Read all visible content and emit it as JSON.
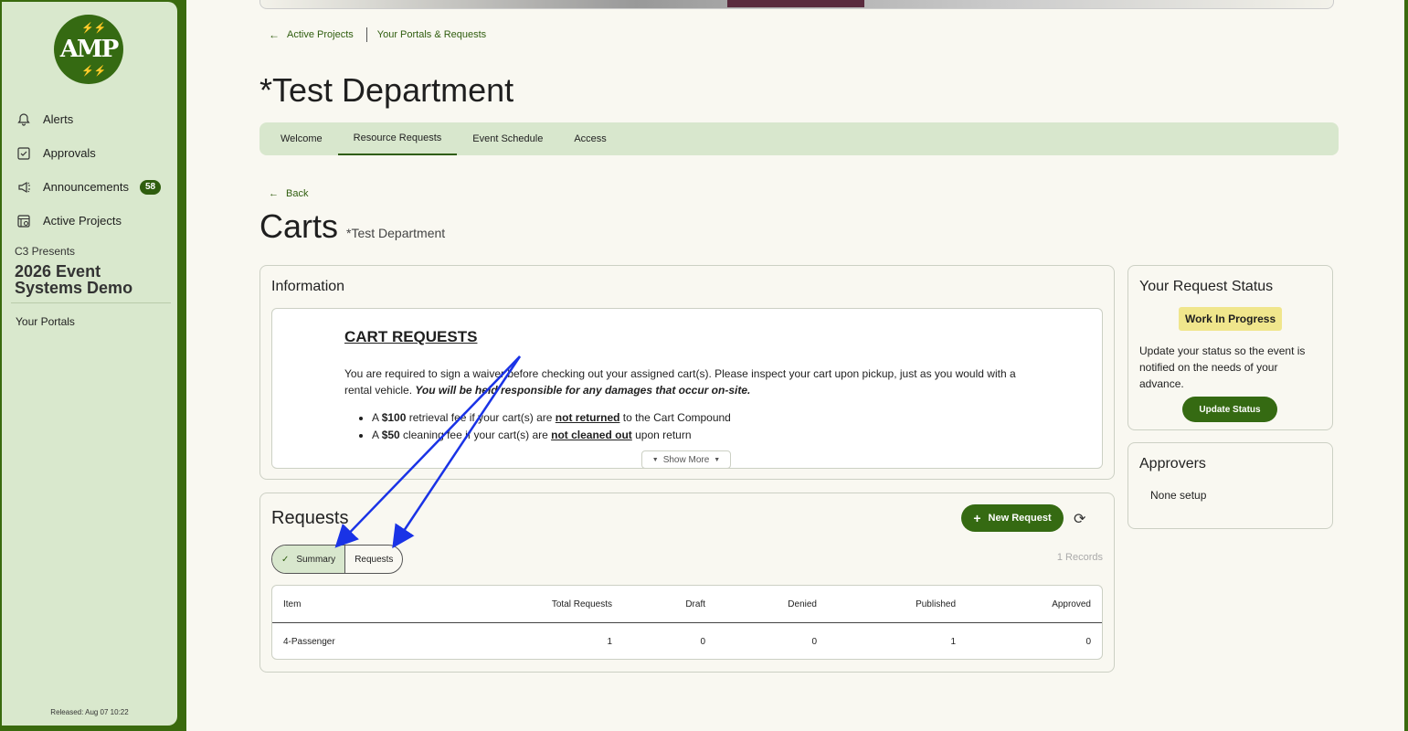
{
  "sidebar": {
    "logo_text": "AMP",
    "nav": [
      {
        "label": "Alerts",
        "icon": "bell-icon"
      },
      {
        "label": "Approvals",
        "icon": "checkbox-icon"
      },
      {
        "label": "Announcements",
        "icon": "megaphone-icon",
        "badge": "58"
      },
      {
        "label": "Active Projects",
        "icon": "projects-icon"
      }
    ],
    "org": "C3 Presents",
    "event": "2026 Event Systems Demo",
    "portals": "Your Portals",
    "released": "Released: Aug 07 10:22"
  },
  "breadcrumb": {
    "first": "Active Projects",
    "second": "Your Portals & Requests"
  },
  "page_title": "*Test Department",
  "tabs": [
    "Welcome",
    "Resource Requests",
    "Event Schedule",
    "Access"
  ],
  "active_tab": "Resource Requests",
  "back_label": "Back",
  "section": {
    "title": "Carts",
    "subtitle": "*Test Department"
  },
  "information": {
    "title": "Information",
    "heading": "CART REQUESTS",
    "paragraph_plain": "You are required to sign a waiver before checking out your assigned cart(s). Please inspect your cart upon pickup, just as you would with a rental vehicle. ",
    "paragraph_emph": "You will be held responsible for any damages that occur on-site.",
    "bullets": [
      {
        "pre": "A ",
        "amount": "$100",
        "mid": " retrieval fee if your cart(s) are ",
        "emph": "not returned",
        "post": " to the Cart Compound"
      },
      {
        "pre": "A ",
        "amount": "$50",
        "mid": " cleaning fee if your cart(s) are ",
        "emph": "not cleaned out",
        "post": " upon return"
      }
    ],
    "show_more": "Show More"
  },
  "requests": {
    "title": "Requests",
    "new_button": "New Request",
    "segments": [
      "Summary",
      "Requests"
    ],
    "records": "1 Records",
    "columns": [
      "Item",
      "Total Requests",
      "Draft",
      "Denied",
      "Published",
      "Approved"
    ],
    "rows": [
      [
        "4-Passenger",
        "1",
        "0",
        "0",
        "1",
        "0"
      ]
    ]
  },
  "status_card": {
    "title": "Your Request Status",
    "badge": "Work In Progress",
    "text": "Update your status so the event is notified on the needs of your advance.",
    "button": "Update Status"
  },
  "approvers": {
    "title": "Approvers",
    "text": "None setup"
  },
  "colors": {
    "brand": "#356a12",
    "sidebar": "#d9e8cd",
    "badge": "#f0e68c",
    "annotation": "#1a33e6"
  }
}
